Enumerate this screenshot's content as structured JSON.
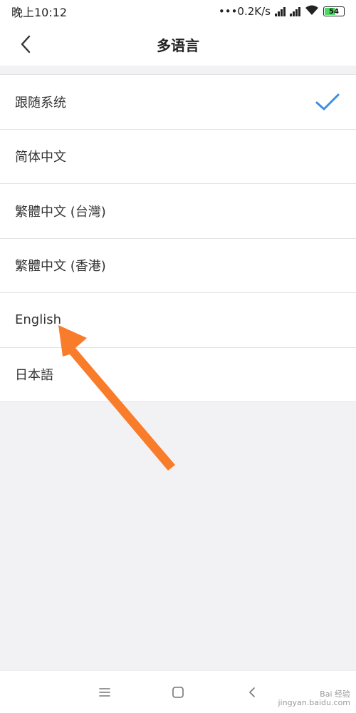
{
  "status_bar": {
    "time": "晚上10:12",
    "network_speed": "•••0.2K/s",
    "battery_level": "54",
    "battery_color": "#4cd964"
  },
  "header": {
    "title": "多语言",
    "back_icon": "chevron-left-icon"
  },
  "languages": [
    {
      "label": "跟随系统",
      "selected": true
    },
    {
      "label": "简体中文",
      "selected": false
    },
    {
      "label": "繁體中文 (台灣)",
      "selected": false
    },
    {
      "label": "繁體中文 (香港)",
      "selected": false
    },
    {
      "label": "English",
      "selected": false
    },
    {
      "label": "日本語",
      "selected": false
    }
  ],
  "accent_color": "#3a8ee6",
  "annotation_color": "#f97c2b",
  "nav_bar": {
    "menu_icon": "menu-icon",
    "home_icon": "home-square-icon",
    "back_icon": "back-triangle-icon"
  },
  "watermark": {
    "brand": "Bai 经验",
    "url": "jingyan.baidu.com"
  }
}
